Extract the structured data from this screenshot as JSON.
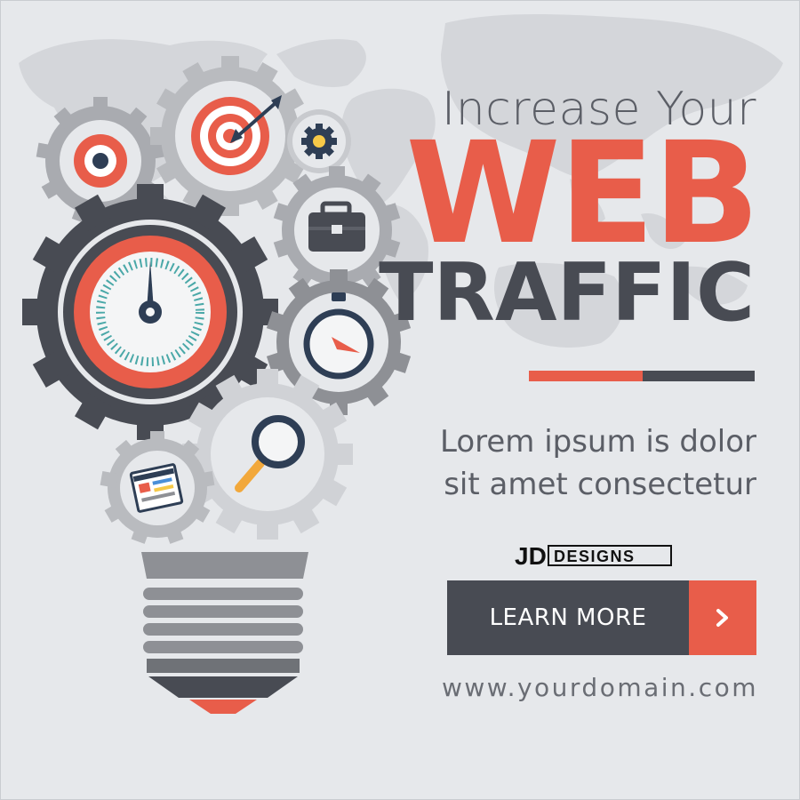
{
  "headline": {
    "line1": "Increase Your",
    "line2": "WEB",
    "line3": "TRAFFIC"
  },
  "tagline": {
    "line1": "Lorem ipsum is dolor",
    "line2": "sit amet consectetur"
  },
  "brand": {
    "logo_text": "JD DESIGNS",
    "logo_part1": "JD",
    "logo_part2": "DESIGNS"
  },
  "cta": {
    "label": "LEARN MORE",
    "icon": "chevron-right-icon"
  },
  "domain": "www.yourdomain.com",
  "colors": {
    "background": "#e6e8eb",
    "accent": "#e85d4a",
    "dark": "#484b53",
    "gear_gray": "#8e9095",
    "gear_light": "#b9bbbf"
  },
  "icons": [
    "world-map-icon",
    "target-icon",
    "small-gear-icon",
    "briefcase-icon",
    "speedometer-icon",
    "stopwatch-icon",
    "magnifier-icon",
    "webpage-icon",
    "lightbulb-base-icon"
  ]
}
